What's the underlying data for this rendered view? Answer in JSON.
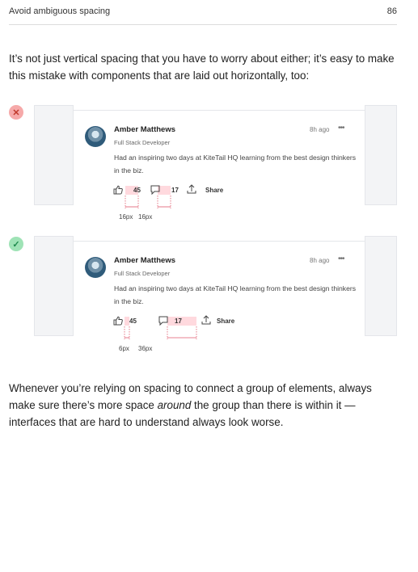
{
  "header": {
    "title": "Avoid ambiguous spacing",
    "page_number": "86"
  },
  "intro": "It’s not just vertical spacing that you have to worry about either; it’s easy to make this mistake with components that are laid out horizontally, too:",
  "examples": [
    {
      "badge": "✕",
      "post": {
        "author": "Amber Matthews",
        "role": "Full Stack Developer",
        "time": "8h ago",
        "more_icon": "•••",
        "text": "Had an inspiring two days at KiteTail HQ learning from the best design thinkers in the biz.",
        "likes": "45",
        "comments": "17",
        "share": "Share"
      },
      "measurements": [
        "16px",
        "16px"
      ]
    },
    {
      "badge": "✓",
      "post": {
        "author": "Amber Matthews",
        "role": "Full Stack Developer",
        "time": "8h ago",
        "more_icon": "•••",
        "text": "Had an inspiring two days at KiteTail HQ learning from the best design thinkers in the biz.",
        "likes": "45",
        "comments": "17",
        "share": "Share"
      },
      "measurements": [
        "6px",
        "36px"
      ]
    }
  ],
  "outro": {
    "before": "Whenever you’re relying on spacing to connect a group of elements, always make sure there’s more space ",
    "emphasis": "around",
    "after": " the group than there is within it — interfaces that are hard to understand always look worse."
  },
  "colors": {
    "bad": "#f6a9a9",
    "good": "#9fe3b6",
    "measure": "#e0596b"
  }
}
